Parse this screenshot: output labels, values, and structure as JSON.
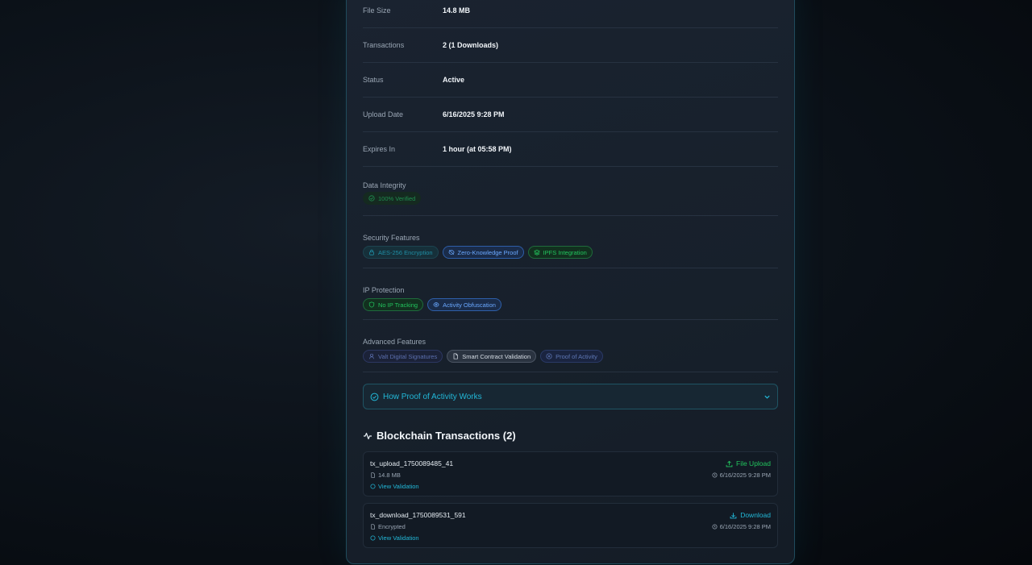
{
  "details": [
    {
      "label": "File Size",
      "value": "14.8 MB"
    },
    {
      "label": "Transactions",
      "value": "2 (1 Downloads)"
    },
    {
      "label": "Status",
      "value": "Active"
    },
    {
      "label": "Upload Date",
      "value": "6/16/2025 9:28 PM"
    },
    {
      "label": "Expires In",
      "value": "1 hour (at 05:58 PM)"
    }
  ],
  "data_integrity": {
    "label": "Data Integrity",
    "badge": "100% Verified"
  },
  "security_features": {
    "label": "Security Features",
    "chips": [
      "AES-256 Encryption",
      "Zero-Knowledge Proof",
      "IPFS Integration"
    ]
  },
  "ip_protection": {
    "label": "IP Protection",
    "chips": [
      "No IP Tracking",
      "Activity Obfuscation"
    ]
  },
  "advanced_features": {
    "label": "Advanced Features",
    "chips": [
      "Valt Digital Signatures",
      "Smart Contract Validation",
      "Proof of Activity"
    ]
  },
  "accordion": {
    "label": "How Proof of Activity Works"
  },
  "transactions": {
    "title": "Blockchain Transactions (2)",
    "items": [
      {
        "id": "tx_upload_1750089485_41",
        "meta": "14.8 MB",
        "link": "View Validation",
        "type": "File Upload",
        "date": "6/16/2025 9:28 PM",
        "type_color": "#22c55e"
      },
      {
        "id": "tx_download_1750089531_591",
        "meta": "Encrypted",
        "link": "View Validation",
        "type": "Download",
        "date": "6/16/2025 9:28 PM",
        "type_color": "#22b8d8"
      }
    ]
  }
}
